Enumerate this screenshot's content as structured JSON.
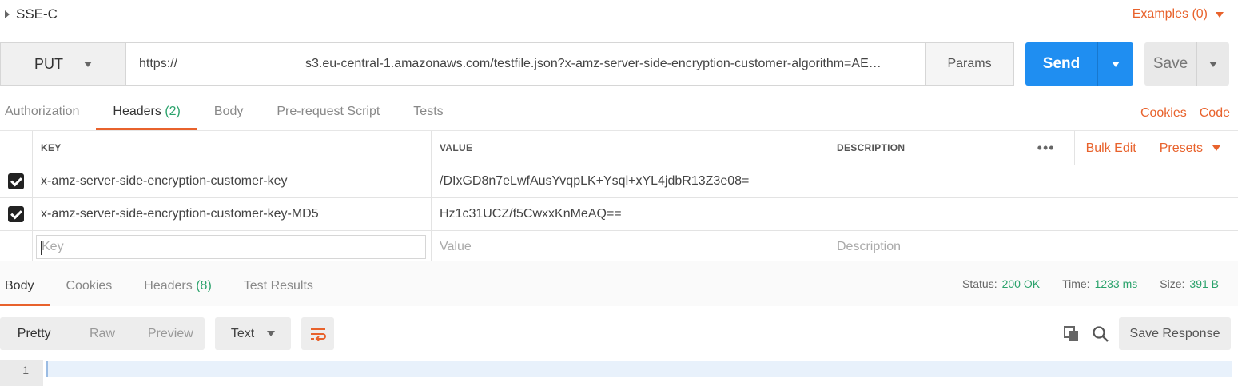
{
  "request": {
    "title": "SSE-C",
    "examples_label": "Examples (0)",
    "method": "PUT",
    "url_prefix": "https://",
    "url_rest": "s3.eu-central-1.amazonaws.com/testfile.json?x-amz-server-side-encryption-customer-algorithm=AE…",
    "params_label": "Params",
    "send_label": "Send",
    "save_label": "Save"
  },
  "req_tabs": [
    {
      "label": "Authorization"
    },
    {
      "label": "Headers",
      "count": "(2)"
    },
    {
      "label": "Body"
    },
    {
      "label": "Pre-request Script"
    },
    {
      "label": "Tests"
    }
  ],
  "req_links": {
    "cookies": "Cookies",
    "code": "Code"
  },
  "headers_table": {
    "columns": {
      "key": "KEY",
      "value": "VALUE",
      "description": "DESCRIPTION"
    },
    "tools": {
      "dots": "•••",
      "bulk_edit": "Bulk Edit",
      "presets": "Presets"
    },
    "rows": [
      {
        "checked": true,
        "key": "x-amz-server-side-encryption-customer-key",
        "value": "/DIxGD8n7eLwfAusYvqpLK+Ysql+xYL4jdbR13Z3e08=",
        "description": ""
      },
      {
        "checked": true,
        "key": "x-amz-server-side-encryption-customer-key-MD5",
        "value": "Hz1c31UCZ/f5CwxxKnMeAQ==",
        "description": ""
      }
    ],
    "placeholders": {
      "key": "Key",
      "value": "Value",
      "description": "Description"
    }
  },
  "resp_tabs": [
    {
      "label": "Body"
    },
    {
      "label": "Cookies"
    },
    {
      "label": "Headers",
      "count": "(8)"
    },
    {
      "label": "Test Results"
    }
  ],
  "status": {
    "status_label": "Status:",
    "status_value": "200 OK",
    "time_label": "Time:",
    "time_value": "1233 ms",
    "size_label": "Size:",
    "size_value": "391 B"
  },
  "view": {
    "pretty": "Pretty",
    "raw": "Raw",
    "preview": "Preview",
    "format": "Text",
    "save_response": "Save Response"
  },
  "editor": {
    "line_number": "1"
  },
  "colors": {
    "accent": "#e8622c",
    "send_blue": "#1f8ef1",
    "status_green": "#2aa26b"
  }
}
